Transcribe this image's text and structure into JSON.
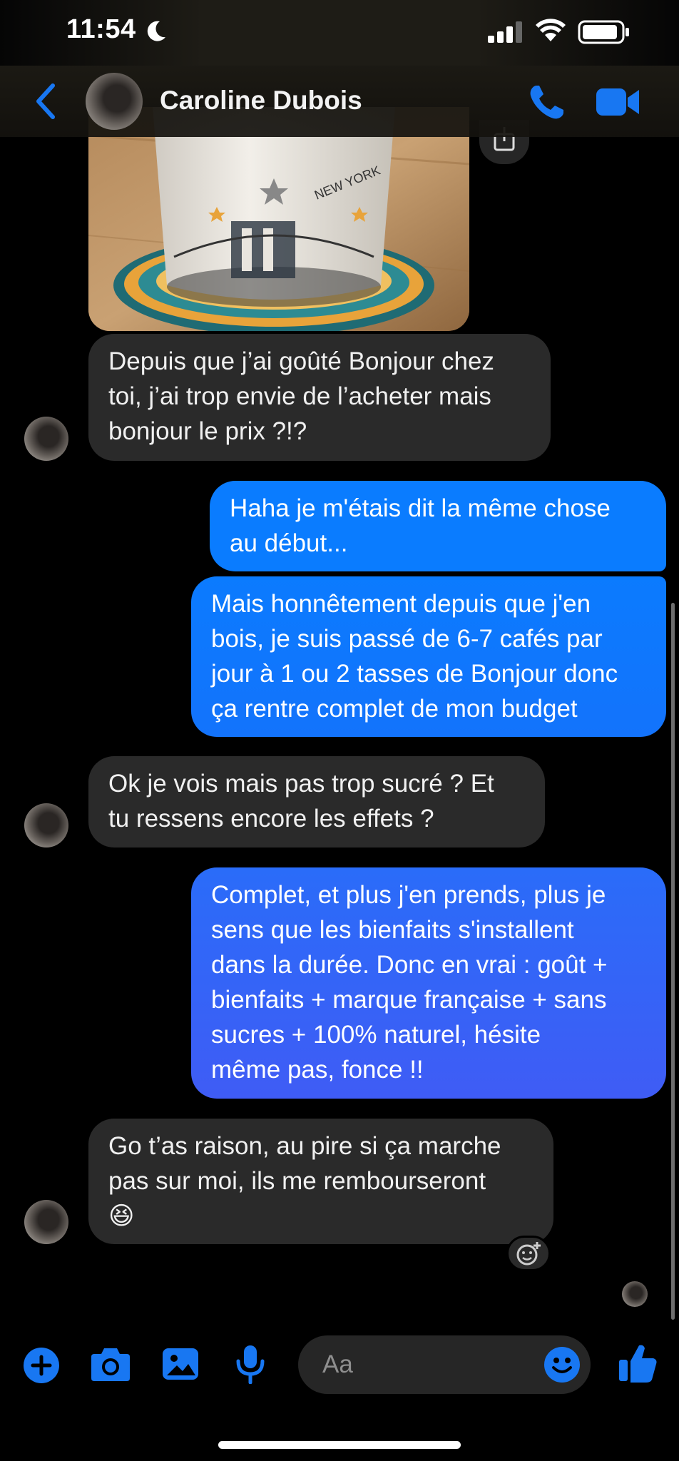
{
  "status_bar": {
    "time": "11:54"
  },
  "header": {
    "contact_name": "Caroline Dubois"
  },
  "messages": [
    {
      "direction": "in",
      "lines": [
        "Depuis que j’ai goûté Bonjour chez",
        "toi, j’ai trop envie de l’acheter mais",
        "bonjour le prix ?!?"
      ]
    },
    {
      "direction": "out",
      "lines": [
        "Haha je m'étais dit la même chose",
        "au début..."
      ]
    },
    {
      "direction": "out",
      "lines": [
        "Mais honnêtement depuis que j'en",
        "bois, je suis passé de 6-7 cafés par",
        "jour à 1 ou 2 tasses de Bonjour donc",
        "ça rentre complet de mon budget"
      ]
    },
    {
      "direction": "in",
      "lines": [
        "Ok je vois mais pas trop sucré ? Et",
        "tu ressens encore les effets ?"
      ]
    },
    {
      "direction": "out",
      "lines": [
        "Complet, et plus j'en prends, plus je",
        "sens que les bienfaits s'installent",
        "dans la durée. Donc en vrai : goût +",
        "bienfaits + marque française + sans",
        "sucres + 100% naturel, hésite",
        "même pas, fonce !!"
      ]
    },
    {
      "direction": "in",
      "lines": [
        "Go t’as raison, au pire si ça marche",
        "pas sur moi, ils me rembourseront",
        "😆"
      ]
    }
  ],
  "photo": {
    "mug_text": "NEW YORK"
  },
  "composer": {
    "placeholder": "Aa"
  },
  "colors": {
    "accent": "#1877f2",
    "bubble_in": "#2a2a2a",
    "bubble_out_top": "#0a7cff",
    "bubble_out_bottom": "#3a5cf5"
  },
  "icons": [
    "back-icon",
    "phone-icon",
    "video-icon",
    "plus-icon",
    "camera-icon",
    "gallery-icon",
    "microphone-icon",
    "emoji-icon",
    "thumbs-up-icon",
    "share-icon",
    "add-reaction-icon"
  ]
}
